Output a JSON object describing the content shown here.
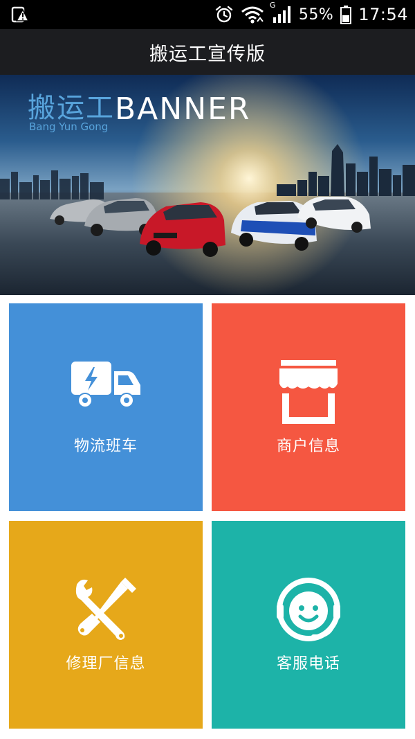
{
  "status_bar": {
    "battery_percent": "55%",
    "time": "17:54",
    "network_type": "G",
    "icons": [
      "warning-icon",
      "alarm-icon",
      "wifi-icon",
      "signal-icon",
      "battery-icon"
    ]
  },
  "title_bar": {
    "title": "搬运工宣传版"
  },
  "banner": {
    "title_cn": "搬运工",
    "title_en": "BANNER",
    "subtitle": "Bang Yun Gong"
  },
  "tiles": [
    {
      "label": "物流班车",
      "icon": "delivery-truck-icon",
      "color": "#4490d8"
    },
    {
      "label": "商户信息",
      "icon": "storefront-icon",
      "color": "#f55741"
    },
    {
      "label": "修理厂信息",
      "icon": "repair-tools-icon",
      "color": "#e6a81a"
    },
    {
      "label": "客服电话",
      "icon": "customer-service-icon",
      "color": "#1db3a8"
    }
  ]
}
